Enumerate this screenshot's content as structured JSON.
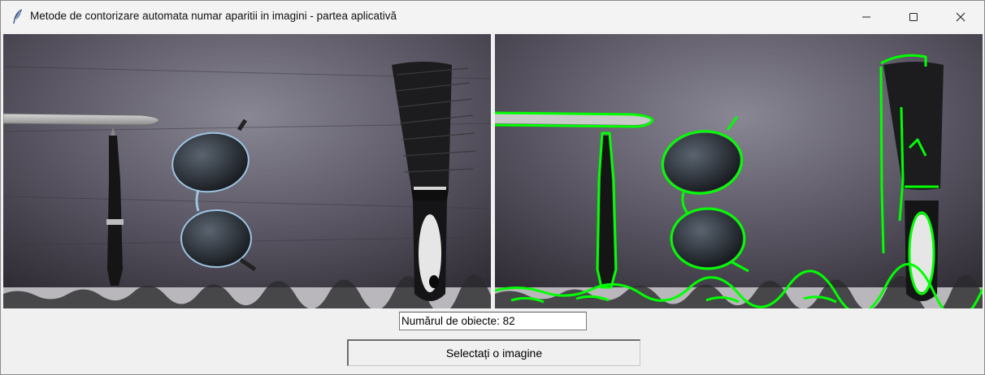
{
  "window": {
    "title": "Metode de contorizare automata numar aparitii in imagini - partea aplicativă",
    "app_icon": "feather-icon",
    "controls": [
      "minimize-icon",
      "maximize-icon",
      "close-icon"
    ]
  },
  "images": {
    "left": "original-photo",
    "right": "contour-detection-result",
    "contour_color": "#00ff00"
  },
  "count": {
    "value": "Numărul de obiecte: 82"
  },
  "actions": {
    "select_image_label": "Selectați o imagine"
  }
}
